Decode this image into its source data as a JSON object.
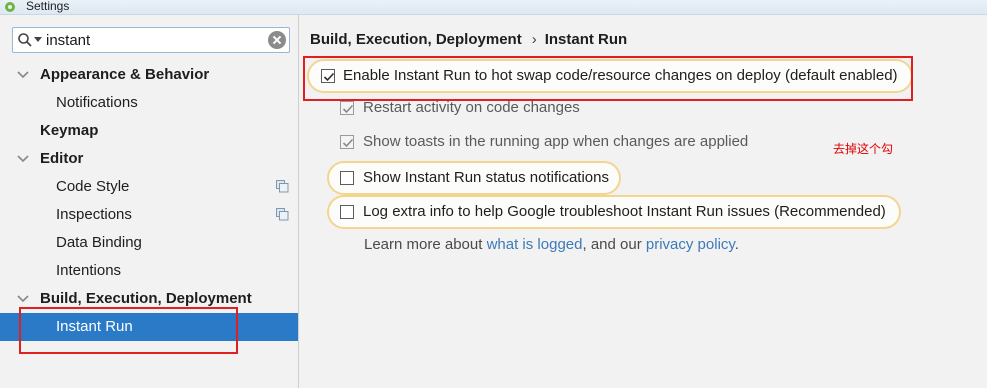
{
  "window": {
    "title": "Settings"
  },
  "search": {
    "value": "instant"
  },
  "tree": {
    "appearance": "Appearance & Behavior",
    "notifications": "Notifications",
    "keymap": "Keymap",
    "editor": "Editor",
    "code_style": "Code Style",
    "inspections": "Inspections",
    "data_binding": "Data Binding",
    "intentions": "Intentions",
    "build": "Build, Execution, Deployment",
    "instant_run": "Instant Run"
  },
  "breadcrumb": {
    "parent": "Build, Execution, Deployment",
    "separator": "›",
    "current": "Instant Run"
  },
  "options": [
    {
      "label": "Enable Instant Run to hot swap code/resource changes on deploy (default enabled)",
      "checked": true
    },
    {
      "label": "Restart activity on code changes",
      "checked": true
    },
    {
      "label": "Show toasts in the running app when changes are applied",
      "checked": true
    },
    {
      "label": "Show Instant Run status notifications",
      "checked": false
    },
    {
      "label": "Log extra info to help Google troubleshoot Instant Run issues (Recommended)",
      "checked": false
    }
  ],
  "learn_more": {
    "prefix": "Learn more about ",
    "link1": "what is logged",
    "middle": ", and our ",
    "link2": "privacy policy",
    "suffix": "."
  },
  "annotation": "去掉这个勾",
  "colors": {
    "selection": "#2a7ac7",
    "link": "#3d7ab8",
    "highlight_border": "#f3d58f",
    "annotation": "#e00000"
  }
}
